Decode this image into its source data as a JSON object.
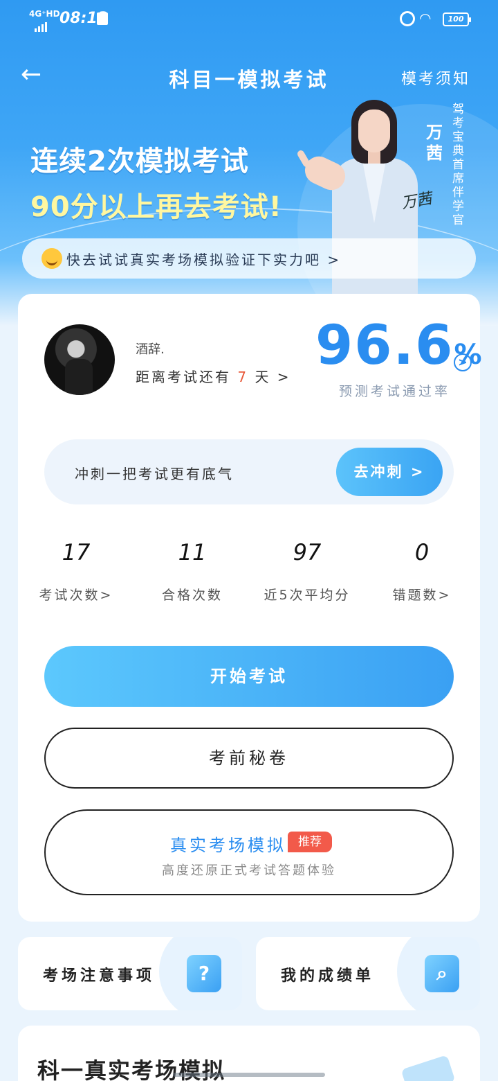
{
  "status_bar": {
    "network": "4G⁺HD",
    "time": "08:13",
    "battery": "100"
  },
  "nav": {
    "back_icon": "arrow-left-icon",
    "title": "科目一模拟考试",
    "notice": "模考须知"
  },
  "banner": {
    "line1": "连续2次模拟考试",
    "line2": "90分以上再去考试!",
    "instructor_name": "万茜",
    "instructor_title": "驾考宝典首席伴学官",
    "signature": "万茜",
    "tip": "快去试试真实考场模拟验证下实力吧 >"
  },
  "profile": {
    "username": "酒辞.",
    "days_prefix": "距离考试还有",
    "days_value": "7",
    "days_suffix": "天 >",
    "pass_rate": "96.6",
    "pass_rate_unit": "%",
    "pass_rate_label": "预测考试通过率"
  },
  "sprint": {
    "text": "冲刺一把考试更有底气",
    "button": "去冲刺 >"
  },
  "stats": [
    {
      "value": "17",
      "label": "考试次数>"
    },
    {
      "value": "11",
      "label": "合格次数"
    },
    {
      "value": "97",
      "label": "近5次平均分"
    },
    {
      "value": "0",
      "label": "错题数>"
    }
  ],
  "buttons": {
    "start": "开始考试",
    "secret": "考前秘卷",
    "real_title": "真实考场模拟",
    "real_tag": "推荐",
    "real_sub": "高度还原正式考试答题体验"
  },
  "mini_cards": {
    "notice_title": "考场注意事项",
    "notice_icon": "question-icon",
    "score_title": "我的成绩单",
    "score_icon": "search-document-icon"
  },
  "bottom": {
    "title": "科一真实考场模拟"
  },
  "colors": {
    "accent": "#2a8df0",
    "hero": "#3fa6f6",
    "highlight": "#e85a3b",
    "tag": "#f25a4a"
  }
}
